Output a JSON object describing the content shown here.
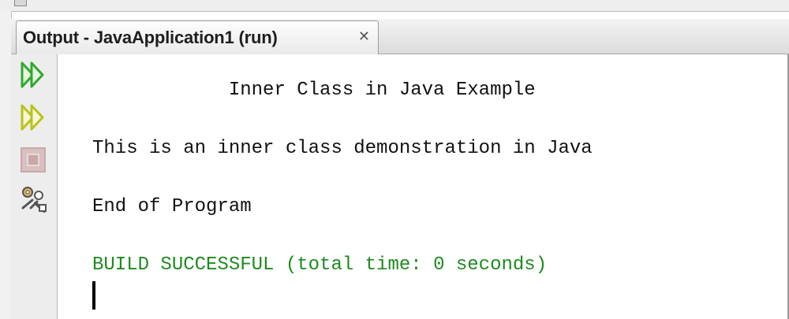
{
  "window": {
    "panel_title": "Output - JavaApplication1 (run)",
    "close_glyph": "✕"
  },
  "toolbar": {
    "buttons": [
      {
        "name": "rerun",
        "icon": "double-play-green-icon"
      },
      {
        "name": "rerun-with-parameters",
        "icon": "double-play-yellow-icon"
      },
      {
        "name": "stop",
        "icon": "stop-square-icon"
      },
      {
        "name": "settings",
        "icon": "wrench-gears-icon"
      }
    ]
  },
  "output": {
    "lines": [
      "            Inner Class in Java Example",
      "This is an inner class demonstration in Java",
      "End of Program",
      "BUILD SUCCESSFUL (total time: 0 seconds)"
    ]
  },
  "colors": {
    "success": "#1f8b1f",
    "run_icon": "#2ea82e",
    "run_params_icon": "#b9c21a"
  }
}
